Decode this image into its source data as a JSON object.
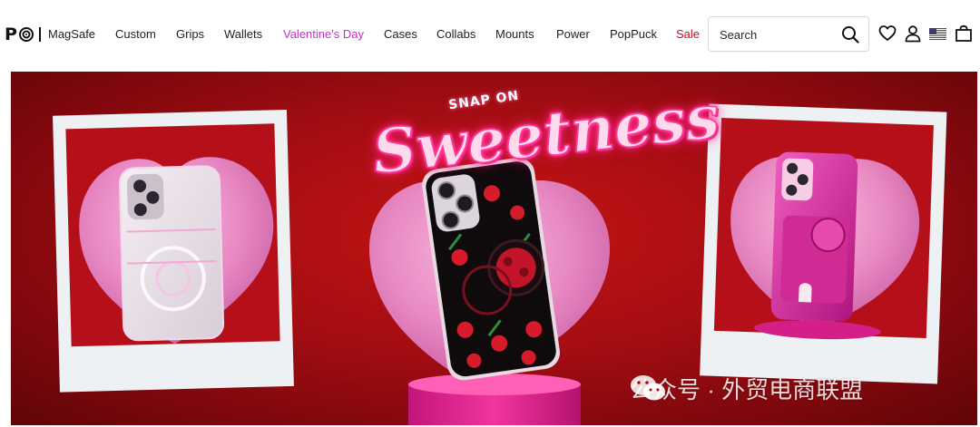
{
  "brand": {
    "logo_letter": "P"
  },
  "nav": {
    "items": [
      {
        "label": "MagSafe"
      },
      {
        "label": "Custom"
      },
      {
        "label": "Grips"
      },
      {
        "label": "Wallets"
      },
      {
        "label": "Valentine's Day",
        "color": "#c72bd1"
      },
      {
        "label": "Cases"
      },
      {
        "label": "Collabs"
      },
      {
        "label": "Mounts"
      },
      {
        "label": "Power"
      },
      {
        "label": "PopPuck"
      },
      {
        "label": "Sale",
        "color": "#c4102a"
      }
    ]
  },
  "search": {
    "placeholder": "Search",
    "icon": "search-icon"
  },
  "header_icons": [
    "heart-icon",
    "account-icon",
    "us-flag-icon",
    "cart-bag-icon"
  ],
  "hero": {
    "eyebrow": "SNAP ON",
    "headline": "Sweetness",
    "background_color": "#b3101a",
    "neon_color": "#ff3d9a"
  },
  "watermark": {
    "text": "公众号 · 外贸电商联盟"
  }
}
